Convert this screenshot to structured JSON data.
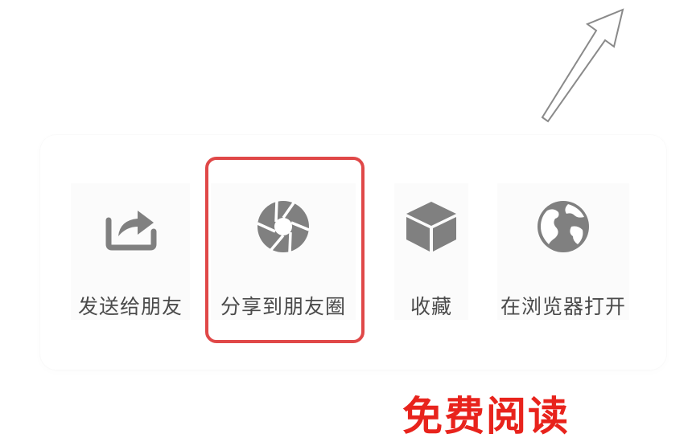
{
  "share_sheet": {
    "actions": [
      {
        "label": "发送给朋友",
        "icon": "share-forward-icon"
      },
      {
        "label": "分享到朋友圈",
        "icon": "moments-aperture-icon"
      },
      {
        "label": "收藏",
        "icon": "favorite-cube-icon"
      },
      {
        "label": "在浏览器打开",
        "icon": "globe-icon"
      }
    ],
    "icon_color": "#808080",
    "label_color": "#4a4a4a"
  },
  "highlight": {
    "target": "分享到朋友圈",
    "color": "#e04848"
  },
  "promo": {
    "text": "免费阅读",
    "color": "#e8231c"
  },
  "hint_arrow": {
    "icon": "up-right-arrow-icon"
  }
}
